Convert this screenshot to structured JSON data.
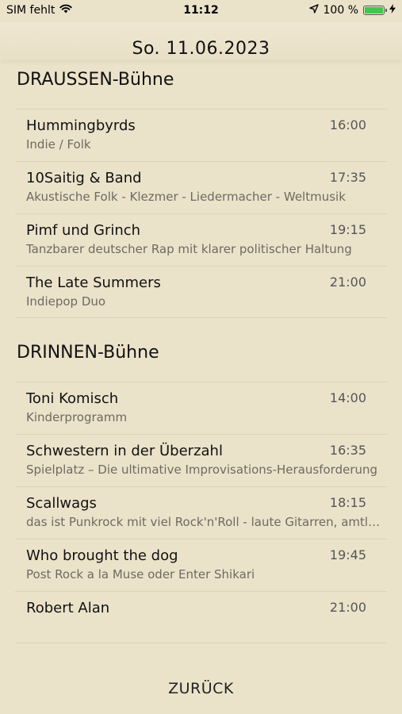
{
  "status_bar": {
    "carrier": "SIM fehlt",
    "time": "11:12",
    "battery": "100 %",
    "battery_color": "#3fc84b",
    "icons": [
      "wifi-icon",
      "location-arrow-icon",
      "battery-icon",
      "charging-bolt-icon"
    ]
  },
  "header": {
    "date": "So. 11.06.2023"
  },
  "sections": [
    {
      "title": "DRAUSSEN-Bühne",
      "items": [
        {
          "name": "Hummingbyrds",
          "time": "16:00",
          "desc": "Indie / Folk"
        },
        {
          "name": "10Saitig & Band",
          "time": "17:35",
          "desc": "Akustische Folk - Klezmer - Liedermacher - Weltmusik"
        },
        {
          "name": "Pimf und Grinch",
          "time": "19:15",
          "desc": "Tanzbarer deutscher Rap mit klarer politischer Haltung"
        },
        {
          "name": "The Late Summers",
          "time": "21:00",
          "desc": "Indiepop Duo"
        }
      ]
    },
    {
      "title": "DRINNEN-Bühne",
      "items": [
        {
          "name": "Toni Komisch",
          "time": "14:00",
          "desc": "Kinderprogramm"
        },
        {
          "name": "Schwestern in der Überzahl",
          "time": "16:35",
          "desc": "Spielplatz – Die ultimative Improvisations-Herausforderung"
        },
        {
          "name": "Scallwags",
          "time": "18:15",
          "desc": "das ist Punkrock mit viel Rock'n'Roll - laute Gitarren, amtli..."
        },
        {
          "name": "Who brought the dog",
          "time": "19:45",
          "desc": "Post Rock a la Muse oder Enter Shikari"
        },
        {
          "name": "Robert Alan",
          "time": "21:00",
          "desc": ""
        }
      ]
    }
  ],
  "back_label": "ZURÜCK"
}
